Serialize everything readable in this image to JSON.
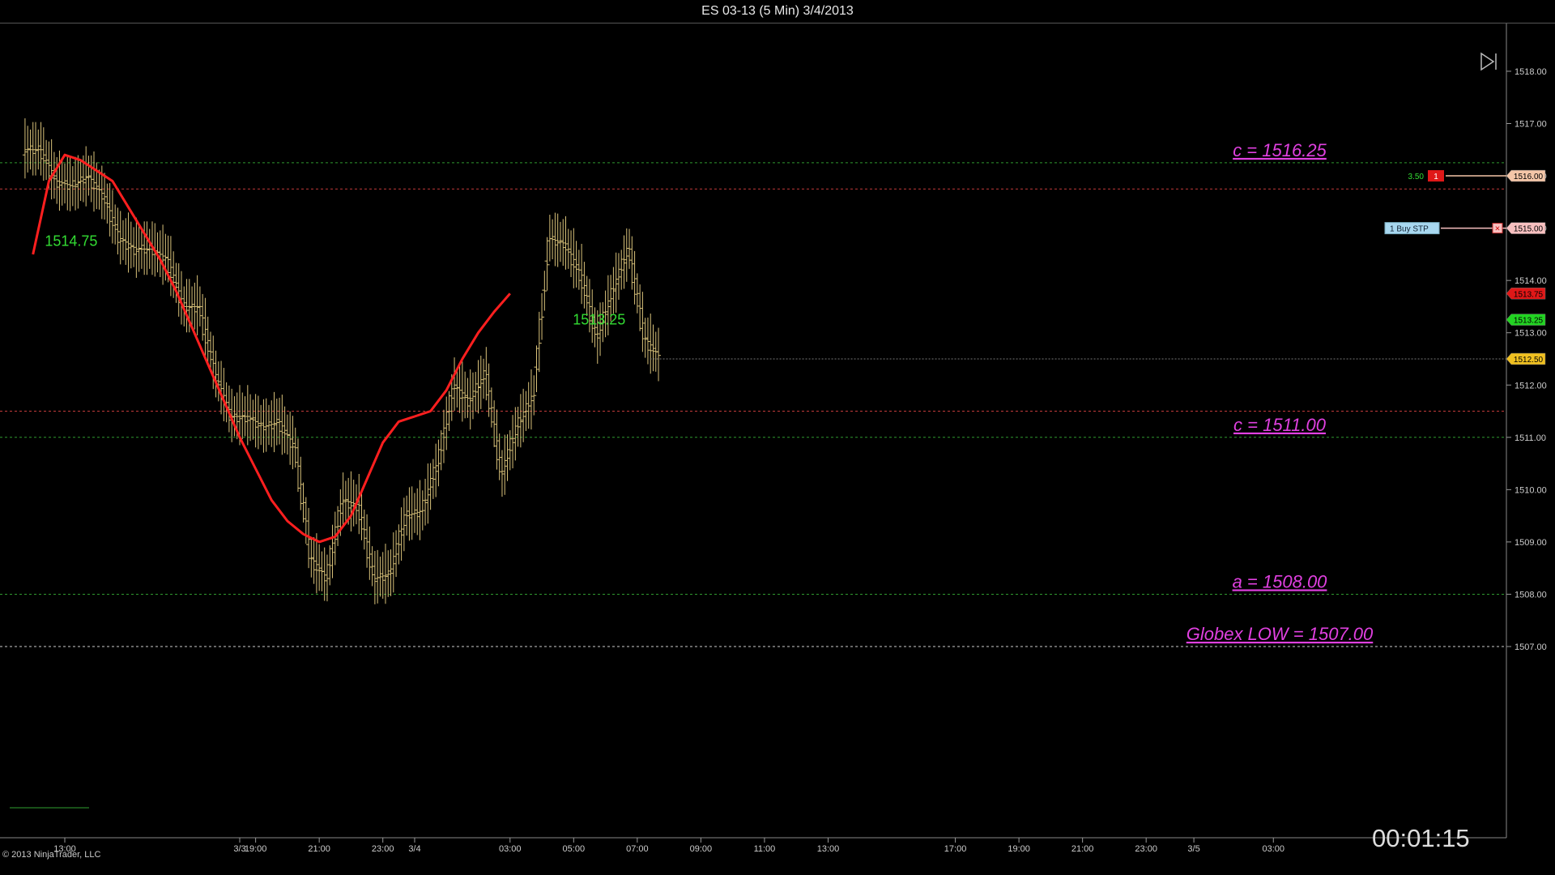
{
  "window": {
    "title": "ES 03-13 (5 Min)  3/4/2013"
  },
  "footer": {
    "copyright": "© 2013 NinjaTrader, LLC",
    "timer": "00:01:15"
  },
  "colors": {
    "background": "#000000",
    "bars": "#d9c27a",
    "moving_average": "#ff1f1f",
    "green_levels": "#2f9a2f",
    "red_levels": "#c23b3b",
    "annotation": "#e040e0",
    "bar_label": "#33dd33"
  },
  "chart_data": {
    "type": "ohlc",
    "instrument": "ES 03-13",
    "interval": "5 Min",
    "ylim": [
      1506.75,
      1518.5
    ],
    "y_ticks": [
      "1507.00",
      "1508.00",
      "1509.00",
      "1510.00",
      "1511.00",
      "1512.00",
      "1513.00",
      "1514.00",
      "1515.00",
      "1516.00",
      "1517.00",
      "1518.00"
    ],
    "x_ticks": [
      "13:00",
      "3/3",
      "19:00",
      "21:00",
      "23:00",
      "3/4",
      "03:00",
      "05:00",
      "07:00",
      "09:00",
      "11:00",
      "13:00",
      "17:00",
      "19:00",
      "21:00",
      "23:00",
      "3/5",
      "03:00"
    ],
    "x_tick_hours": [
      13,
      18.5,
      19,
      21,
      23,
      24,
      27,
      29,
      31,
      33,
      35,
      37,
      41,
      43,
      45,
      47,
      48.5,
      51
    ],
    "price_series": {
      "hours": [
        12.0,
        12.5,
        13.0,
        13.5,
        14.0,
        14.5,
        15.0,
        15.5,
        16.0,
        16.5,
        17.0,
        17.5,
        18.0,
        18.5,
        19.0,
        19.5,
        20.0,
        20.5,
        21.0,
        21.5,
        22.0,
        22.5,
        23.0,
        23.5,
        24.0,
        24.5,
        25.0,
        25.5,
        26.0,
        26.5,
        27.0,
        27.5,
        28.0,
        28.5,
        29.0,
        29.5,
        30.0,
        30.5,
        31.0,
        31.5
      ],
      "closes": [
        1516.5,
        1515.9,
        1515.8,
        1516.0,
        1515.6,
        1514.8,
        1514.6,
        1514.6,
        1514.4,
        1513.5,
        1513.5,
        1512.2,
        1511.4,
        1511.4,
        1511.2,
        1511.3,
        1510.8,
        1508.7,
        1508.3,
        1509.8,
        1509.7,
        1508.3,
        1508.4,
        1509.5,
        1509.6,
        1510.5,
        1512.0,
        1511.7,
        1512.2,
        1510.3,
        1511.2,
        1511.8,
        1514.8,
        1514.7,
        1514.1,
        1512.9,
        1513.8,
        1514.6,
        1512.9,
        1512.5
      ]
    },
    "moving_average": {
      "hours": [
        12.0,
        12.5,
        13.0,
        13.5,
        14.0,
        14.5,
        15.0,
        15.5,
        16.0,
        16.5,
        17.0,
        17.5,
        18.0,
        18.5,
        19.0,
        19.5,
        20.0,
        20.5,
        21.0,
        21.5,
        22.0,
        22.5,
        23.0,
        23.5,
        24.0,
        24.5,
        25.0,
        25.5,
        26.0,
        26.5,
        27.0,
        27.5,
        28.0,
        28.5,
        29.0,
        29.5,
        30.0,
        30.5,
        31.0,
        31.5
      ],
      "values": [
        1514.5,
        1515.9,
        1516.4,
        1516.3,
        1516.1,
        1515.9,
        1515.4,
        1514.9,
        1514.4,
        1513.8,
        1513.1,
        1512.4,
        1511.7,
        1511.0,
        1510.4,
        1509.8,
        1509.4,
        1509.15,
        1509.0,
        1509.1,
        1509.5,
        1510.2,
        1510.9,
        1511.3,
        1511.4,
        1511.5,
        1511.9,
        1512.5,
        1513.0,
        1513.4,
        1513.75
      ]
    },
    "bar_labels": [
      {
        "text": "1514.75"
      },
      {
        "text": "1513.25"
      }
    ],
    "levels": [
      {
        "price": 1516.25,
        "color": "green",
        "label": "c = 1516.25"
      },
      {
        "price": 1515.75,
        "color": "red",
        "label": ""
      },
      {
        "price": 1511.5,
        "color": "red",
        "label": ""
      },
      {
        "price": 1511.0,
        "color": "green",
        "label": "c = 1511.00"
      },
      {
        "price": 1508.0,
        "color": "green",
        "label": "a = 1508.00"
      },
      {
        "price": 1507.0,
        "color": "white",
        "label": "Globex LOW = 1507.00"
      }
    ],
    "price_markers": [
      {
        "price": 1516.0,
        "text": "1516.00",
        "bg": "#f4c6a8"
      },
      {
        "price": 1515.0,
        "text": "1515.00",
        "bg": "#f8c0c0"
      },
      {
        "price": 1513.75,
        "text": "1513.75",
        "bg": "#e01818"
      },
      {
        "price": 1513.25,
        "text": "1513.25",
        "bg": "#22d422"
      },
      {
        "price": 1512.5,
        "text": "1512.50",
        "bg": "#f0c020"
      }
    ],
    "orders": [
      {
        "price": 1516.0,
        "pnl": "3.50",
        "qty": "1"
      },
      {
        "price": 1515.0,
        "label": "1  Buy STP"
      }
    ]
  }
}
